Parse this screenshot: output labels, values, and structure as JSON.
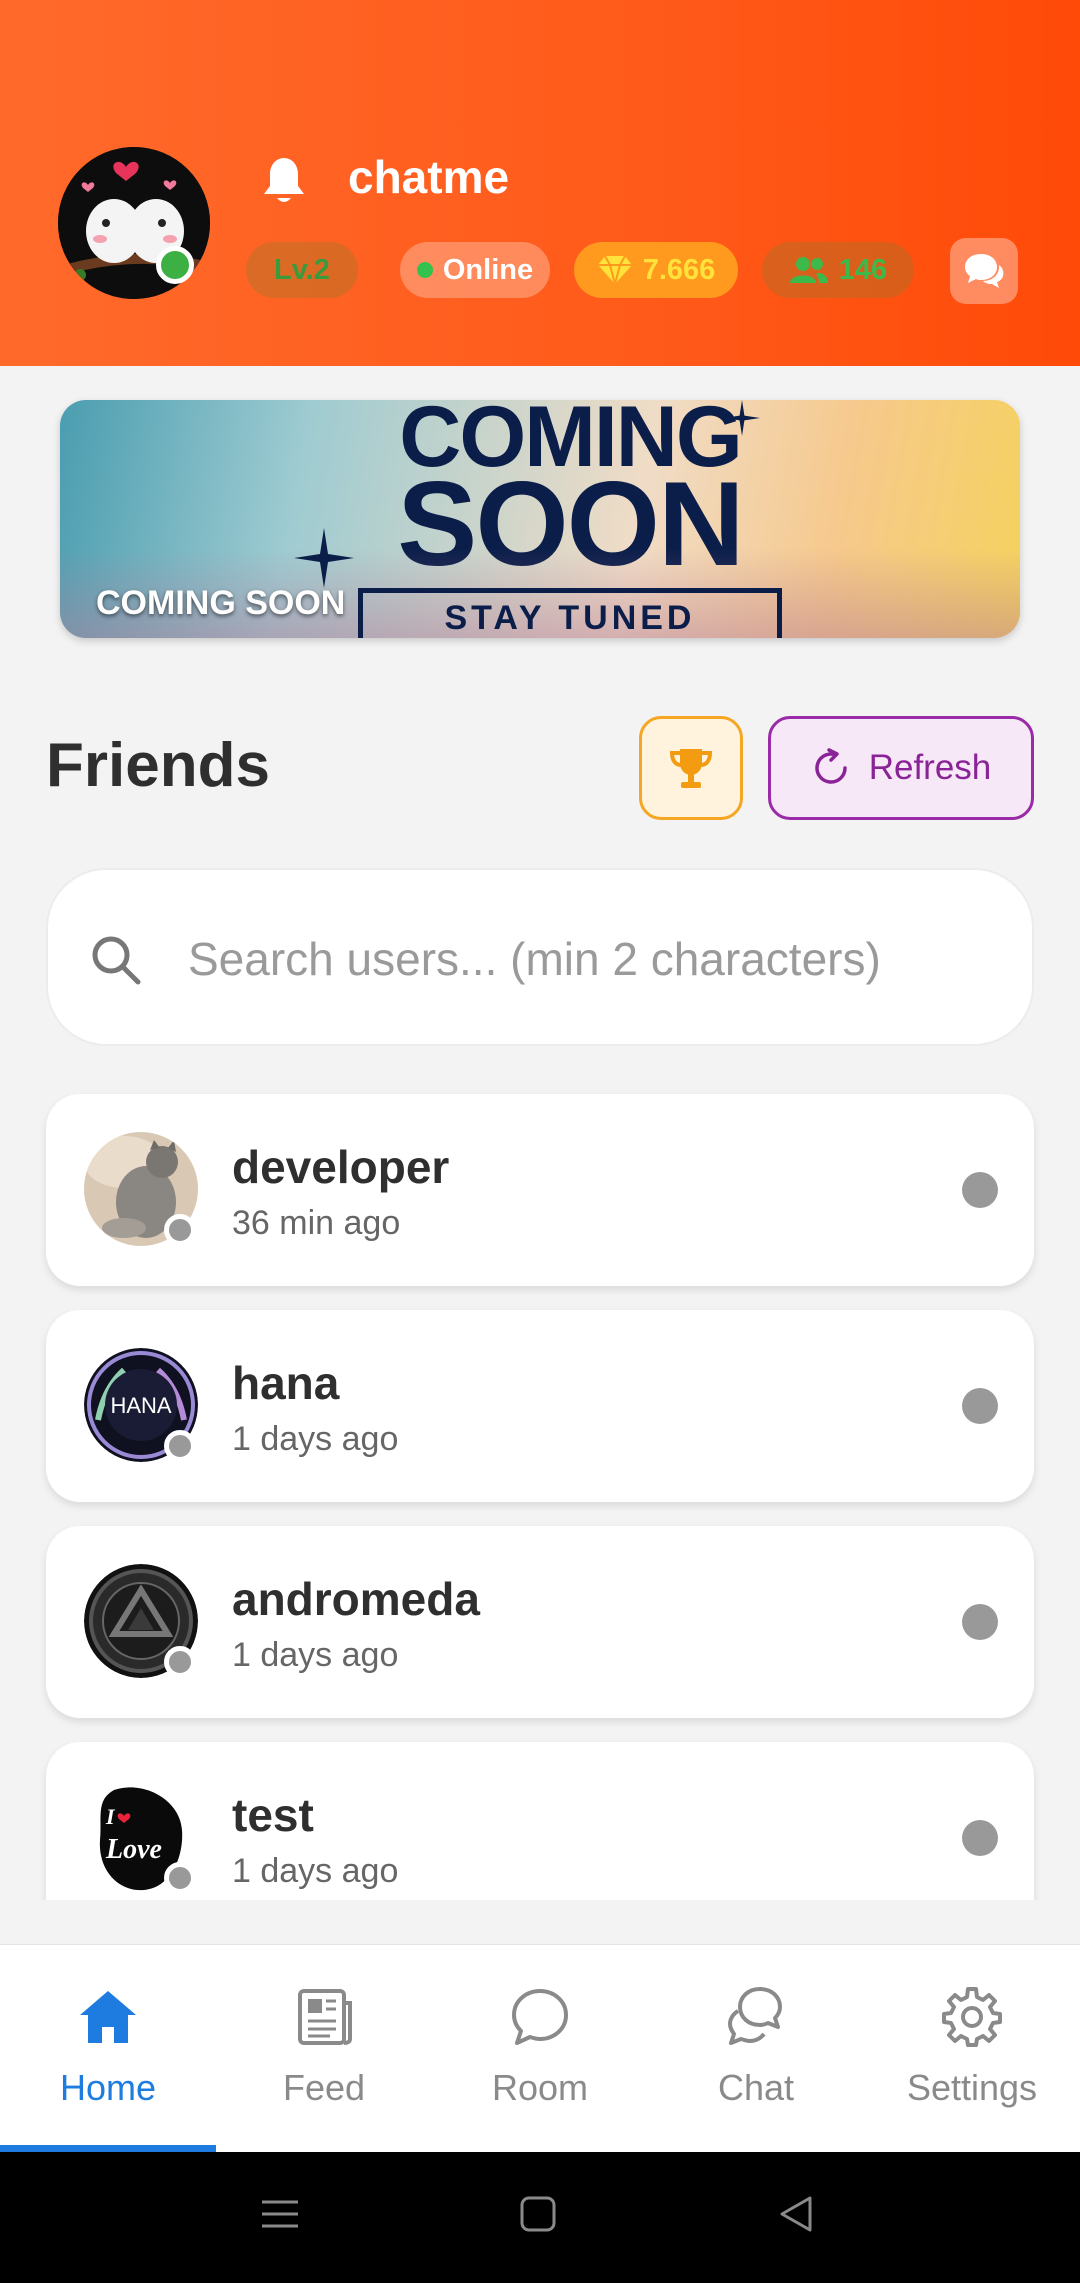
{
  "header": {
    "username": "chatme",
    "level": "Lv.2",
    "status": "Online",
    "gems": "7.666",
    "friends_count": "146",
    "colors": {
      "accent": "#ff5a1a",
      "online": "#3cb043"
    }
  },
  "banner": {
    "caption": "COMING SOON",
    "headline_top": "COMING",
    "headline_bottom": "SOON",
    "tagline": "STAY TUNED"
  },
  "friends": {
    "title": "Friends",
    "refresh_label": "Refresh",
    "search_placeholder": "Search users... (min 2 characters)",
    "items": [
      {
        "name": "developer",
        "last_seen": "36 min ago",
        "avatar": "cat-photo"
      },
      {
        "name": "hana",
        "last_seen": "1 days ago",
        "avatar": "hana-badge",
        "avatar_text": "HANA"
      },
      {
        "name": "andromeda",
        "last_seen": "1 days ago",
        "avatar": "dark-emblem"
      },
      {
        "name": "test",
        "last_seen": "1 days ago",
        "avatar": "love-silhouette",
        "avatar_text": "Love"
      }
    ]
  },
  "nav": {
    "items": [
      {
        "label": "Home",
        "icon": "home-icon",
        "active": true
      },
      {
        "label": "Feed",
        "icon": "feed-icon",
        "active": false
      },
      {
        "label": "Room",
        "icon": "room-icon",
        "active": false
      },
      {
        "label": "Chat",
        "icon": "chat-icon",
        "active": false
      },
      {
        "label": "Settings",
        "icon": "gear-icon",
        "active": false
      }
    ],
    "colors": {
      "active": "#1e7be0",
      "inactive": "#8a8a8a"
    }
  }
}
